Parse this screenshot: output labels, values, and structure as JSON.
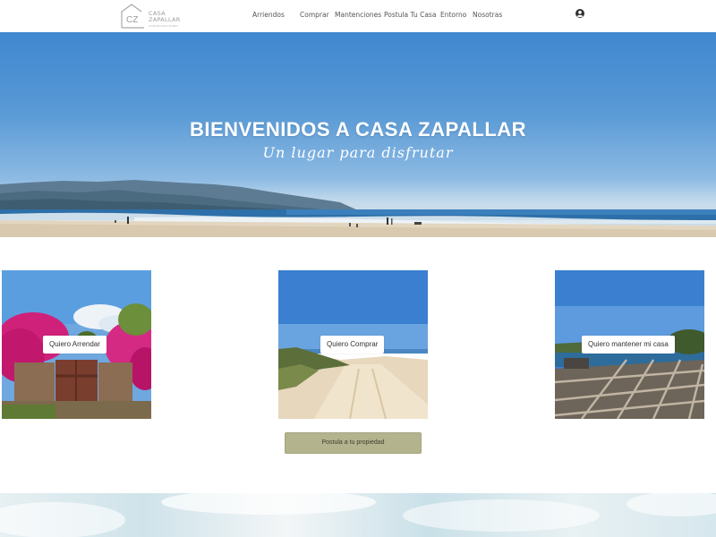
{
  "header": {
    "logo": {
      "mark": "CZ",
      "line1": "CASA",
      "line2": "ZAPALLAR",
      "tagline": "ADMINISTRACIONES"
    },
    "nav": [
      {
        "label": "Arriendos"
      },
      {
        "label": "Comprar"
      },
      {
        "label": "Mantenciones"
      },
      {
        "label": "Postula Tu Casa"
      },
      {
        "label": "Entorno"
      },
      {
        "label": "Nosotras"
      }
    ],
    "user_icon": "user-circle-icon"
  },
  "hero": {
    "title": "BIENVENIDOS A CASA ZAPALLAR",
    "subtitle": "Un lugar para disfrutar"
  },
  "cards": [
    {
      "label": "Quiero Arrendar"
    },
    {
      "label": "Quiero Comprar"
    },
    {
      "label": "Quiero mantener mi casa"
    }
  ],
  "cta": {
    "label": "Postula a tu propiedad"
  },
  "colors": {
    "accent": "#b3b48e",
    "sky": "#3f87cf",
    "sand": "#e3d6c0"
  }
}
